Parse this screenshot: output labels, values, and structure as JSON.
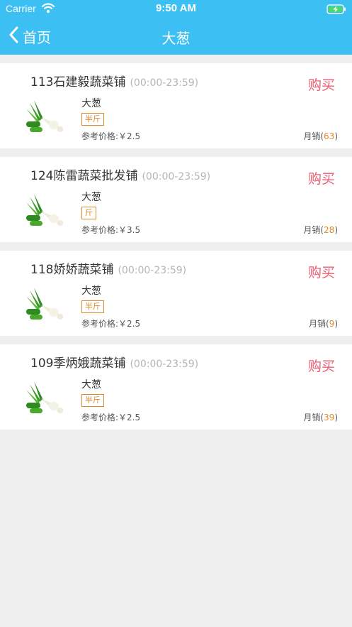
{
  "status_bar": {
    "carrier": "Carrier",
    "time": "9:50 AM"
  },
  "nav": {
    "back_label": "首页",
    "title": "大葱"
  },
  "shops": [
    {
      "name": "113石建毅蔬菜铺",
      "hours": "(00:00-23:59)",
      "buy_label": "购买",
      "product": "大葱",
      "unit": "半斤",
      "price_label": "参考价格:￥2.5",
      "sales_prefix": "月销(",
      "sales_count": "63",
      "sales_suffix": ")"
    },
    {
      "name": "124陈雷蔬菜批发铺",
      "hours": "(00:00-23:59)",
      "buy_label": "购买",
      "product": "大葱",
      "unit": "斤",
      "price_label": "参考价格:￥3.5",
      "sales_prefix": "月销(",
      "sales_count": "28",
      "sales_suffix": ")"
    },
    {
      "name": "118娇娇蔬菜铺",
      "hours": "(00:00-23:59)",
      "buy_label": "购买",
      "product": "大葱",
      "unit": "半斤",
      "price_label": "参考价格:￥2.5",
      "sales_prefix": "月销(",
      "sales_count": "9",
      "sales_suffix": ")"
    },
    {
      "name": "109季炳娥蔬菜铺",
      "hours": "(00:00-23:59)",
      "buy_label": "购买",
      "product": "大葱",
      "unit": "半斤",
      "price_label": "参考价格:￥2.5",
      "sales_prefix": "月销(",
      "sales_count": "39",
      "sales_suffix": ")"
    }
  ],
  "colors": {
    "header": "#3cbff3",
    "buy": "#ef5b6f",
    "accent": "#e08a2c"
  },
  "icons": {
    "back": "chevron-left-icon",
    "wifi": "wifi-icon",
    "battery": "battery-charging-icon",
    "product": "green-onion-image"
  }
}
